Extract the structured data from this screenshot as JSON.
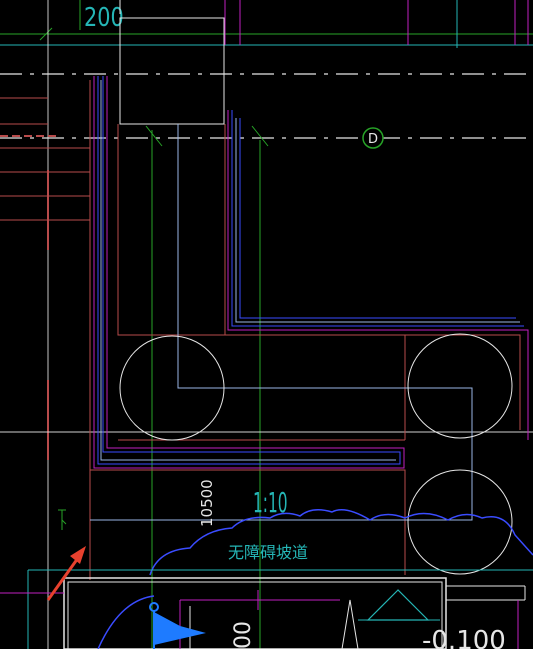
{
  "drawing": {
    "top_dimension_fragment": "200",
    "axis_bubble_label": "D",
    "length_dimension": "10500",
    "slope_ratio": "1:10",
    "ramp_label": "无障碍坡道",
    "elevation_fragment": "-0.100",
    "side_dimension_fragment": "00",
    "colors": {
      "background": "#000000",
      "red": "#b84b4b",
      "magenta": "#c020c0",
      "blue": "#3a4cff",
      "light_blue": "#9ab6e6",
      "green": "#27a327",
      "white": "#e6e6e6",
      "cyan": "#25b6b6",
      "selection_arrow": "#e8412e",
      "cursor_flag": "#1e7bff"
    }
  }
}
